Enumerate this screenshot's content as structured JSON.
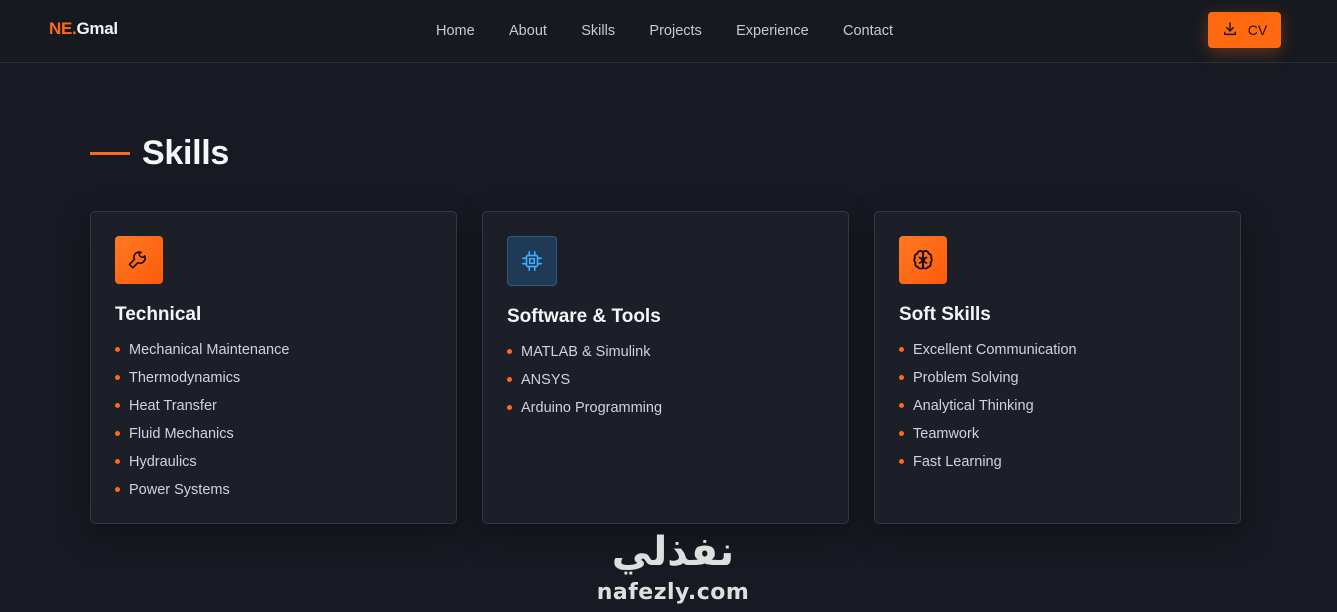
{
  "brand": {
    "logo_accent": "NE.",
    "logo_rest": "Gmal",
    "accent_color": "#ff6a1a"
  },
  "nav": {
    "items": [
      {
        "label": "Home"
      },
      {
        "label": "About"
      },
      {
        "label": "Skills"
      },
      {
        "label": "Projects"
      },
      {
        "label": "Experience"
      },
      {
        "label": "Contact"
      }
    ],
    "cv_button": {
      "label": "CV",
      "icon": "download-icon"
    }
  },
  "skills_section": {
    "title": "Skills",
    "cards": [
      {
        "icon": "wrench-icon",
        "title": "Technical",
        "items": [
          "Mechanical Maintenance",
          "Thermodynamics",
          "Heat Transfer",
          "Fluid Mechanics",
          "Hydraulics",
          "Power Systems"
        ]
      },
      {
        "icon": "cpu-chip-icon",
        "title": "Software & Tools",
        "items": [
          "MATLAB & Simulink",
          "ANSYS",
          "Arduino Programming"
        ]
      },
      {
        "icon": "brain-icon",
        "title": "Soft Skills",
        "items": [
          "Excellent Communication",
          "Problem Solving",
          "Analytical Thinking",
          "Teamwork",
          "Fast Learning"
        ]
      }
    ]
  },
  "watermark": {
    "arabic": "نفذلي",
    "latin": "nafezly.com"
  }
}
